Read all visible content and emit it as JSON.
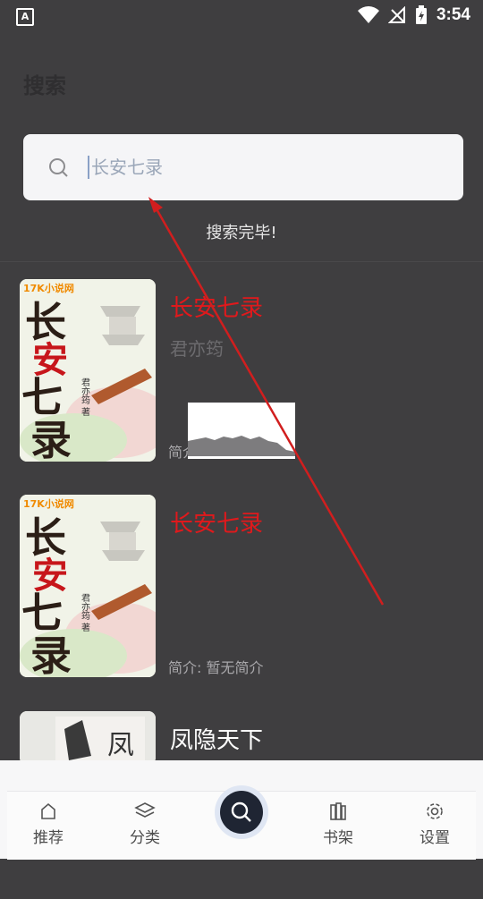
{
  "status_bar": {
    "app_icon_letter": "A",
    "time": "3:54"
  },
  "header": {
    "title": "搜索"
  },
  "search": {
    "value": "长安七录"
  },
  "status_message": "搜索完毕!",
  "results": [
    {
      "title": "长安七录",
      "author": "君亦筠",
      "intro": "简介: 暂无简介",
      "cover_badge": "17K小说网",
      "cover_title": "长安七录",
      "cover_author": "君亦筠 著"
    },
    {
      "title": "长安七录",
      "author": "",
      "intro": "简介: 暂无简介",
      "cover_badge": "17K小说网",
      "cover_title": "长安七录",
      "cover_author": "君亦筠 著"
    },
    {
      "title": "凤隐天下",
      "author": "",
      "intro": "",
      "cover_title": "凤"
    }
  ],
  "nav": {
    "recommend": "推荐",
    "category": "分类",
    "bookshelf": "书架",
    "settings": "设置"
  },
  "colors": {
    "background": "#3f3e40",
    "title_red": "#e0191c",
    "annotation_red": "#d11e1e"
  }
}
